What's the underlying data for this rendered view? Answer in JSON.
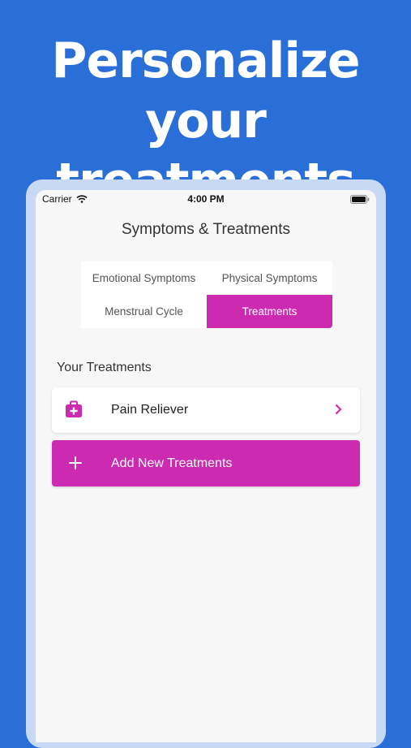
{
  "headline": {
    "line1": "Personalize",
    "line2": "your treatments"
  },
  "status_bar": {
    "carrier": "Carrier",
    "time": "4:00 PM"
  },
  "nav": {
    "title": "Symptoms & Treatments"
  },
  "segments": [
    {
      "label": "Emotional Symptoms",
      "active": false
    },
    {
      "label": "Physical Symptoms",
      "active": false
    },
    {
      "label": "Menstrual Cycle",
      "active": false
    },
    {
      "label": "Treatments",
      "active": true
    }
  ],
  "section": {
    "title": "Your Treatments"
  },
  "treatments": [
    {
      "label": "Pain Reliever",
      "icon": "medical-kit-icon"
    }
  ],
  "add_button": {
    "label": "Add New Treatments",
    "icon": "plus-icon"
  },
  "colors": {
    "background": "#2a6fd8",
    "accent": "#cc2ab0",
    "device_frame": "#c8d9f5",
    "screen": "#f7f7f8"
  }
}
